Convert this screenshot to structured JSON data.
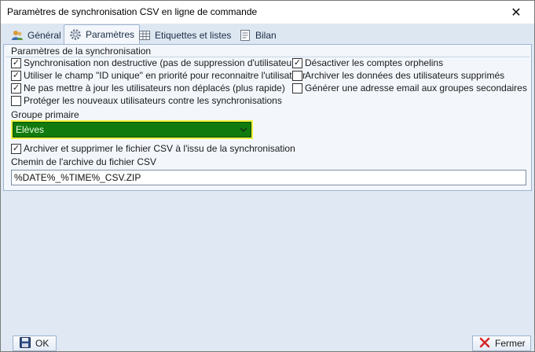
{
  "window": {
    "title": "Paramètres de synchronisation CSV en ligne de commande",
    "close_glyph": "✕"
  },
  "tabs": [
    {
      "label": "Général",
      "icon": "users-icon",
      "active": false
    },
    {
      "label": "Paramètres",
      "icon": "gear-icon",
      "active": true
    },
    {
      "label": "Etiquettes et listes",
      "icon": "table-icon",
      "active": false
    },
    {
      "label": "Bilan",
      "icon": "report-icon",
      "active": false
    }
  ],
  "sync": {
    "group_title": "Paramètres de la synchronisation",
    "options_left": [
      {
        "label": "Synchronisation non destructive (pas de suppression d'utilisateurs)",
        "checked": true
      },
      {
        "label": "Utiliser le champ \"ID unique\" en priorité pour reconnaitre l'utilisateur",
        "checked": true
      },
      {
        "label": "Ne pas mettre à jour les utilisateurs non déplacés (plus rapide)",
        "checked": true
      },
      {
        "label": "Protéger les nouveaux utilisateurs contre les synchronisations",
        "checked": false
      }
    ],
    "options_right": [
      {
        "label": "Désactiver les comptes orphelins",
        "checked": true
      },
      {
        "label": "Archiver les données des utilisateurs supprimés",
        "checked": false
      },
      {
        "label": "Générer une adresse email aux groupes secondaires",
        "checked": false
      }
    ],
    "primary_group_label": "Groupe primaire",
    "primary_group_value": "Elèves",
    "archive_option": {
      "label": "Archiver et supprimer le fichier CSV à l'issu de la synchronisation",
      "checked": true
    },
    "archive_path_label": "Chemin de l'archive du fichier CSV",
    "archive_path_value": "%DATE%_%TIME%_CSV.ZIP"
  },
  "footer": {
    "ok_label": "OK",
    "close_label": "Fermer"
  },
  "colors": {
    "highlight": "#f0f23c",
    "combo_bg": "#117a0e",
    "panel_bg": "#f3f7fc",
    "window_bg": "#dfe8f3"
  }
}
